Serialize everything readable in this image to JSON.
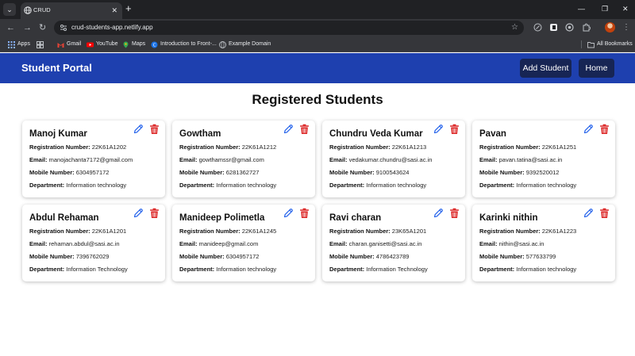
{
  "browser": {
    "tab_menu_icon": "chevron-down-icon",
    "tab_title": "CRUD",
    "url": "crud-students-app.netlify.app",
    "bookmarks": [
      {
        "label": "Apps",
        "icon": "apps-grid-icon"
      },
      {
        "label": "",
        "icon": "tab-groups-icon"
      },
      {
        "label": "Gmail",
        "icon": "gmail-icon",
        "color": "#ea4335"
      },
      {
        "label": "YouTube",
        "icon": "youtube-icon",
        "color": "#ff0000"
      },
      {
        "label": "Maps",
        "icon": "maps-icon",
        "color": "#34a853"
      },
      {
        "label": "Introduction to Front-...",
        "icon": "site-icon",
        "color": "#1a73e8"
      },
      {
        "label": "Example Domain",
        "icon": "globe-icon"
      }
    ],
    "all_bookmarks": "All Bookmarks"
  },
  "header": {
    "brand": "Student Portal",
    "add_student": "Add Student",
    "home": "Home",
    "color": "#1e40af",
    "button_color": "#172554"
  },
  "main": {
    "title": "Registered Students",
    "labels": {
      "reg": "Registration Number:",
      "email": "Email:",
      "mobile": "Mobile Number:",
      "dept": "Department:"
    },
    "students": [
      {
        "name": "Manoj Kumar",
        "reg": "22K61A1202",
        "email": "manojachanta7172@gmail.com",
        "mobile": "6304957172",
        "dept": "Information technology"
      },
      {
        "name": "Gowtham",
        "reg": "22K61A1212",
        "email": "gowthamssr@gmail.com",
        "mobile": "6281362727",
        "dept": "Information technology"
      },
      {
        "name": "Chundru Veda Kumar",
        "reg": "22K61A1213",
        "email": "vedakumar.chundru@sasi.ac.in",
        "mobile": "9100543624",
        "dept": "Information technology"
      },
      {
        "name": "Pavan",
        "reg": "22K61A1251",
        "email": "pavan.tatina@sasi.ac.in",
        "mobile": "9392520012",
        "dept": "Information technology"
      },
      {
        "name": "Abdul Rehaman",
        "reg": "22K61A1201",
        "email": "rehaman.abdul@sasi.ac.in",
        "mobile": "7396762029",
        "dept": "Information Technology"
      },
      {
        "name": "Manideep Polimetla",
        "reg": "22K61A1245",
        "email": "manideep@gmail.com",
        "mobile": "6304957172",
        "dept": "Information technology"
      },
      {
        "name": "Ravi charan",
        "reg": "23K65A1201",
        "email": "charan.ganisetti@sasi.ac.in",
        "mobile": "4786423789",
        "dept": "Information Technology"
      },
      {
        "name": "Karinki nithin",
        "reg": "22K61A1223",
        "email": "nithin@sasi.ac.in",
        "mobile": "577633799",
        "dept": "Information technology"
      }
    ],
    "edit_color": "#2563eb",
    "delete_color": "#dc2626"
  }
}
